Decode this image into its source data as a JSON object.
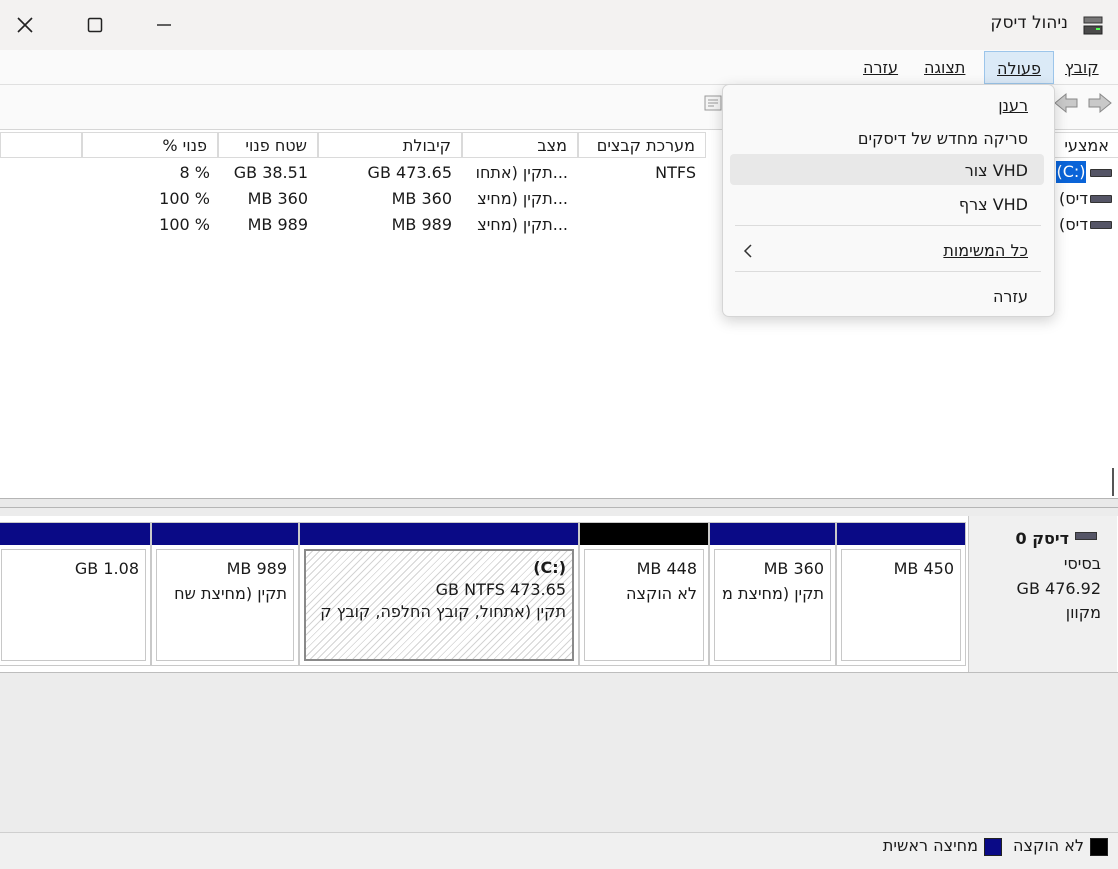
{
  "window": {
    "title": "ניהול דיסק",
    "close_icon": "close-icon",
    "maximize_icon": "maximize-icon",
    "minimize_icon": "minimize-icon"
  },
  "menubar": {
    "items": [
      {
        "label": "קובץ",
        "active": false
      },
      {
        "label": "פעולה",
        "active": true
      },
      {
        "label": "תצוגה",
        "active": false
      },
      {
        "label": "עזרה",
        "active": false
      }
    ]
  },
  "volume_table": {
    "columns": [
      "אמצעי",
      "מערכת קבצים",
      "מצב",
      "קיבולת",
      "שטח פנוי",
      "% פנוי"
    ],
    "rows": [
      {
        "name": "(C:)",
        "fs": "NTFS",
        "status": "תקין (אתחו...",
        "capacity": "GB 473.65",
        "free": "GB 38.51",
        "pct": "8 %",
        "selected": true
      },
      {
        "name": "(דיס",
        "fs": "",
        "status": "תקין (מחיצ...",
        "capacity": "MB 360",
        "free": "MB 360",
        "pct": "100 %",
        "selected": false
      },
      {
        "name": "(דיס",
        "fs": "",
        "status": "תקין (מחיצ...",
        "capacity": "MB 989",
        "free": "MB 989",
        "pct": "100 %",
        "selected": false
      }
    ]
  },
  "disk0": {
    "name": "דיסק 0",
    "type": "בסיסי",
    "size": "GB 476.92",
    "status": "מקוון",
    "partitions": [
      {
        "line1": "MB 450",
        "line2": "",
        "bar_color": "#0a0a86"
      },
      {
        "line1": "MB 360",
        "line2": "תקין (מחיצת מ",
        "bar_color": "#0a0a86"
      },
      {
        "line1": "MB 448",
        "line2": "לא הוקצה",
        "bar_color": "#000000"
      },
      {
        "title": "(C:)",
        "line1": "GB NTFS 473.65",
        "line2": "תקין (אתחול, קובץ החלפה, קובץ ק",
        "bar_color": "#0a0a86",
        "selected": true
      },
      {
        "line1": "MB 989",
        "line2": "תקין (מחיצת שח",
        "bar_color": "#0a0a86"
      },
      {
        "line1": "GB 1.08",
        "line2": "",
        "bar_color": "#0a0a86"
      }
    ]
  },
  "legend": {
    "unallocated": "לא הוקצה",
    "primary": "מחיצה ראשית",
    "unallocated_color": "#000000",
    "primary_color": "#0a0a86"
  },
  "action_menu": {
    "items": [
      {
        "label": "רענן"
      },
      {
        "label": "סריקה מחדש של דיסקים"
      },
      {
        "label": "צור VHD",
        "highlighted": true
      },
      {
        "label": "צרף VHD"
      },
      {
        "label": "כל המשימות",
        "submenu": true
      },
      {
        "label": "עזרה"
      }
    ]
  }
}
